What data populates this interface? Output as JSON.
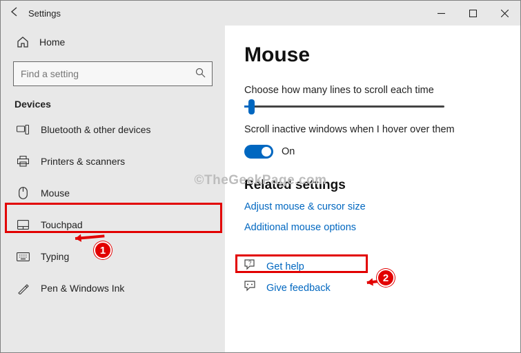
{
  "window": {
    "title": "Settings"
  },
  "sidebar": {
    "home": "Home",
    "search_placeholder": "Find a setting",
    "category": "Devices",
    "items": [
      {
        "label": "Bluetooth & other devices"
      },
      {
        "label": "Printers & scanners"
      },
      {
        "label": "Mouse"
      },
      {
        "label": "Touchpad"
      },
      {
        "label": "Typing"
      },
      {
        "label": "Pen & Windows Ink"
      }
    ]
  },
  "main": {
    "heading": "Mouse",
    "scroll_lines_label": "Choose how many lines to scroll each time",
    "inactive_label": "Scroll inactive windows when I hover over them",
    "toggle_state": "On",
    "related_heading": "Related settings",
    "link_adjust": "Adjust mouse & cursor size",
    "link_additional": "Additional mouse options",
    "help_get": "Get help",
    "help_feedback": "Give feedback"
  },
  "watermark": "©TheGeekPage.com",
  "annotations": {
    "one": "1",
    "two": "2"
  }
}
